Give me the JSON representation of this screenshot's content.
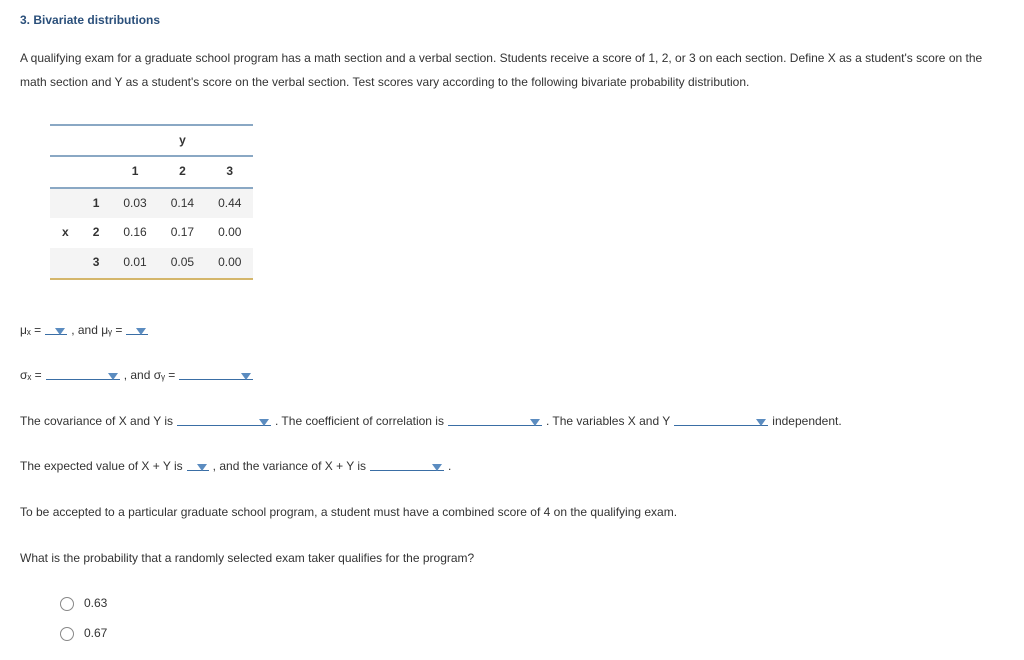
{
  "heading": "3. Bivariate distributions",
  "intro": "A qualifying exam for a graduate school program has a math section and a verbal section. Students receive a score of 1, 2, or 3 on each section. Define X as a student's score on the math section and Y as a student's score on the verbal section. Test scores vary according to the following bivariate probability distribution.",
  "table": {
    "yLabel": "y",
    "xLabel": "x",
    "yHeaders": [
      "1",
      "2",
      "3"
    ],
    "xHeaders": [
      "1",
      "2",
      "3"
    ],
    "rows": [
      [
        "0.03",
        "0.14",
        "0.44"
      ],
      [
        "0.16",
        "0.17",
        "0.00"
      ],
      [
        "0.01",
        "0.05",
        "0.00"
      ]
    ]
  },
  "q": {
    "mux_prefix": "μₓ = ",
    "muy_prefix": " , and μᵧ = ",
    "sigx_prefix": "σₓ = ",
    "sigy_prefix": " , and σᵧ = ",
    "cov_prefix": "The covariance of X and Y is ",
    "corr_prefix": " . The coefficient of correlation is ",
    "vars_prefix": " . The variables X and Y ",
    "indep_suffix": " independent.",
    "exp_prefix": "The expected value of X + Y is ",
    "var_prefix": " , and the variance of X + Y is ",
    "period": " .",
    "accept": "To be accepted to a particular graduate school program, a student must have a combined score of 4 on the qualifying exam.",
    "probq": "What is the probability that a randomly selected exam taker qualifies for the program?"
  },
  "options": {
    "a": "0.63",
    "b": "0.67"
  }
}
